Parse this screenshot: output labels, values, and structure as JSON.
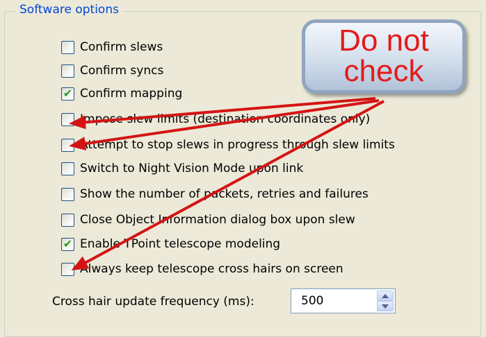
{
  "group": {
    "title": "Software options"
  },
  "options": [
    {
      "label": "Confirm slews",
      "checked": false
    },
    {
      "label": "Confirm syncs",
      "checked": false
    },
    {
      "label": "Confirm mapping",
      "checked": true
    },
    {
      "label": "Impose slew limits (destination coordinates only)",
      "checked": false
    },
    {
      "label": "Attempt to stop slews in progress through slew limits",
      "checked": false
    },
    {
      "label": "Switch to Night Vision Mode upon link",
      "checked": false
    },
    {
      "label": "Show the number of packets, retries and failures",
      "checked": false
    },
    {
      "label": "Close Object Information dialog box upon slew",
      "checked": false
    },
    {
      "label": "Enable TPoint telescope modeling",
      "checked": true
    },
    {
      "label": "Always keep telescope cross hairs on screen",
      "checked": false
    }
  ],
  "frequency": {
    "label": "Cross hair update frequency (ms):",
    "value": "500"
  },
  "callout": {
    "line1": "Do not",
    "line2": "check"
  },
  "colors": {
    "accent": "#0046d5",
    "arrow": "#d41414",
    "check": "#21a121"
  }
}
